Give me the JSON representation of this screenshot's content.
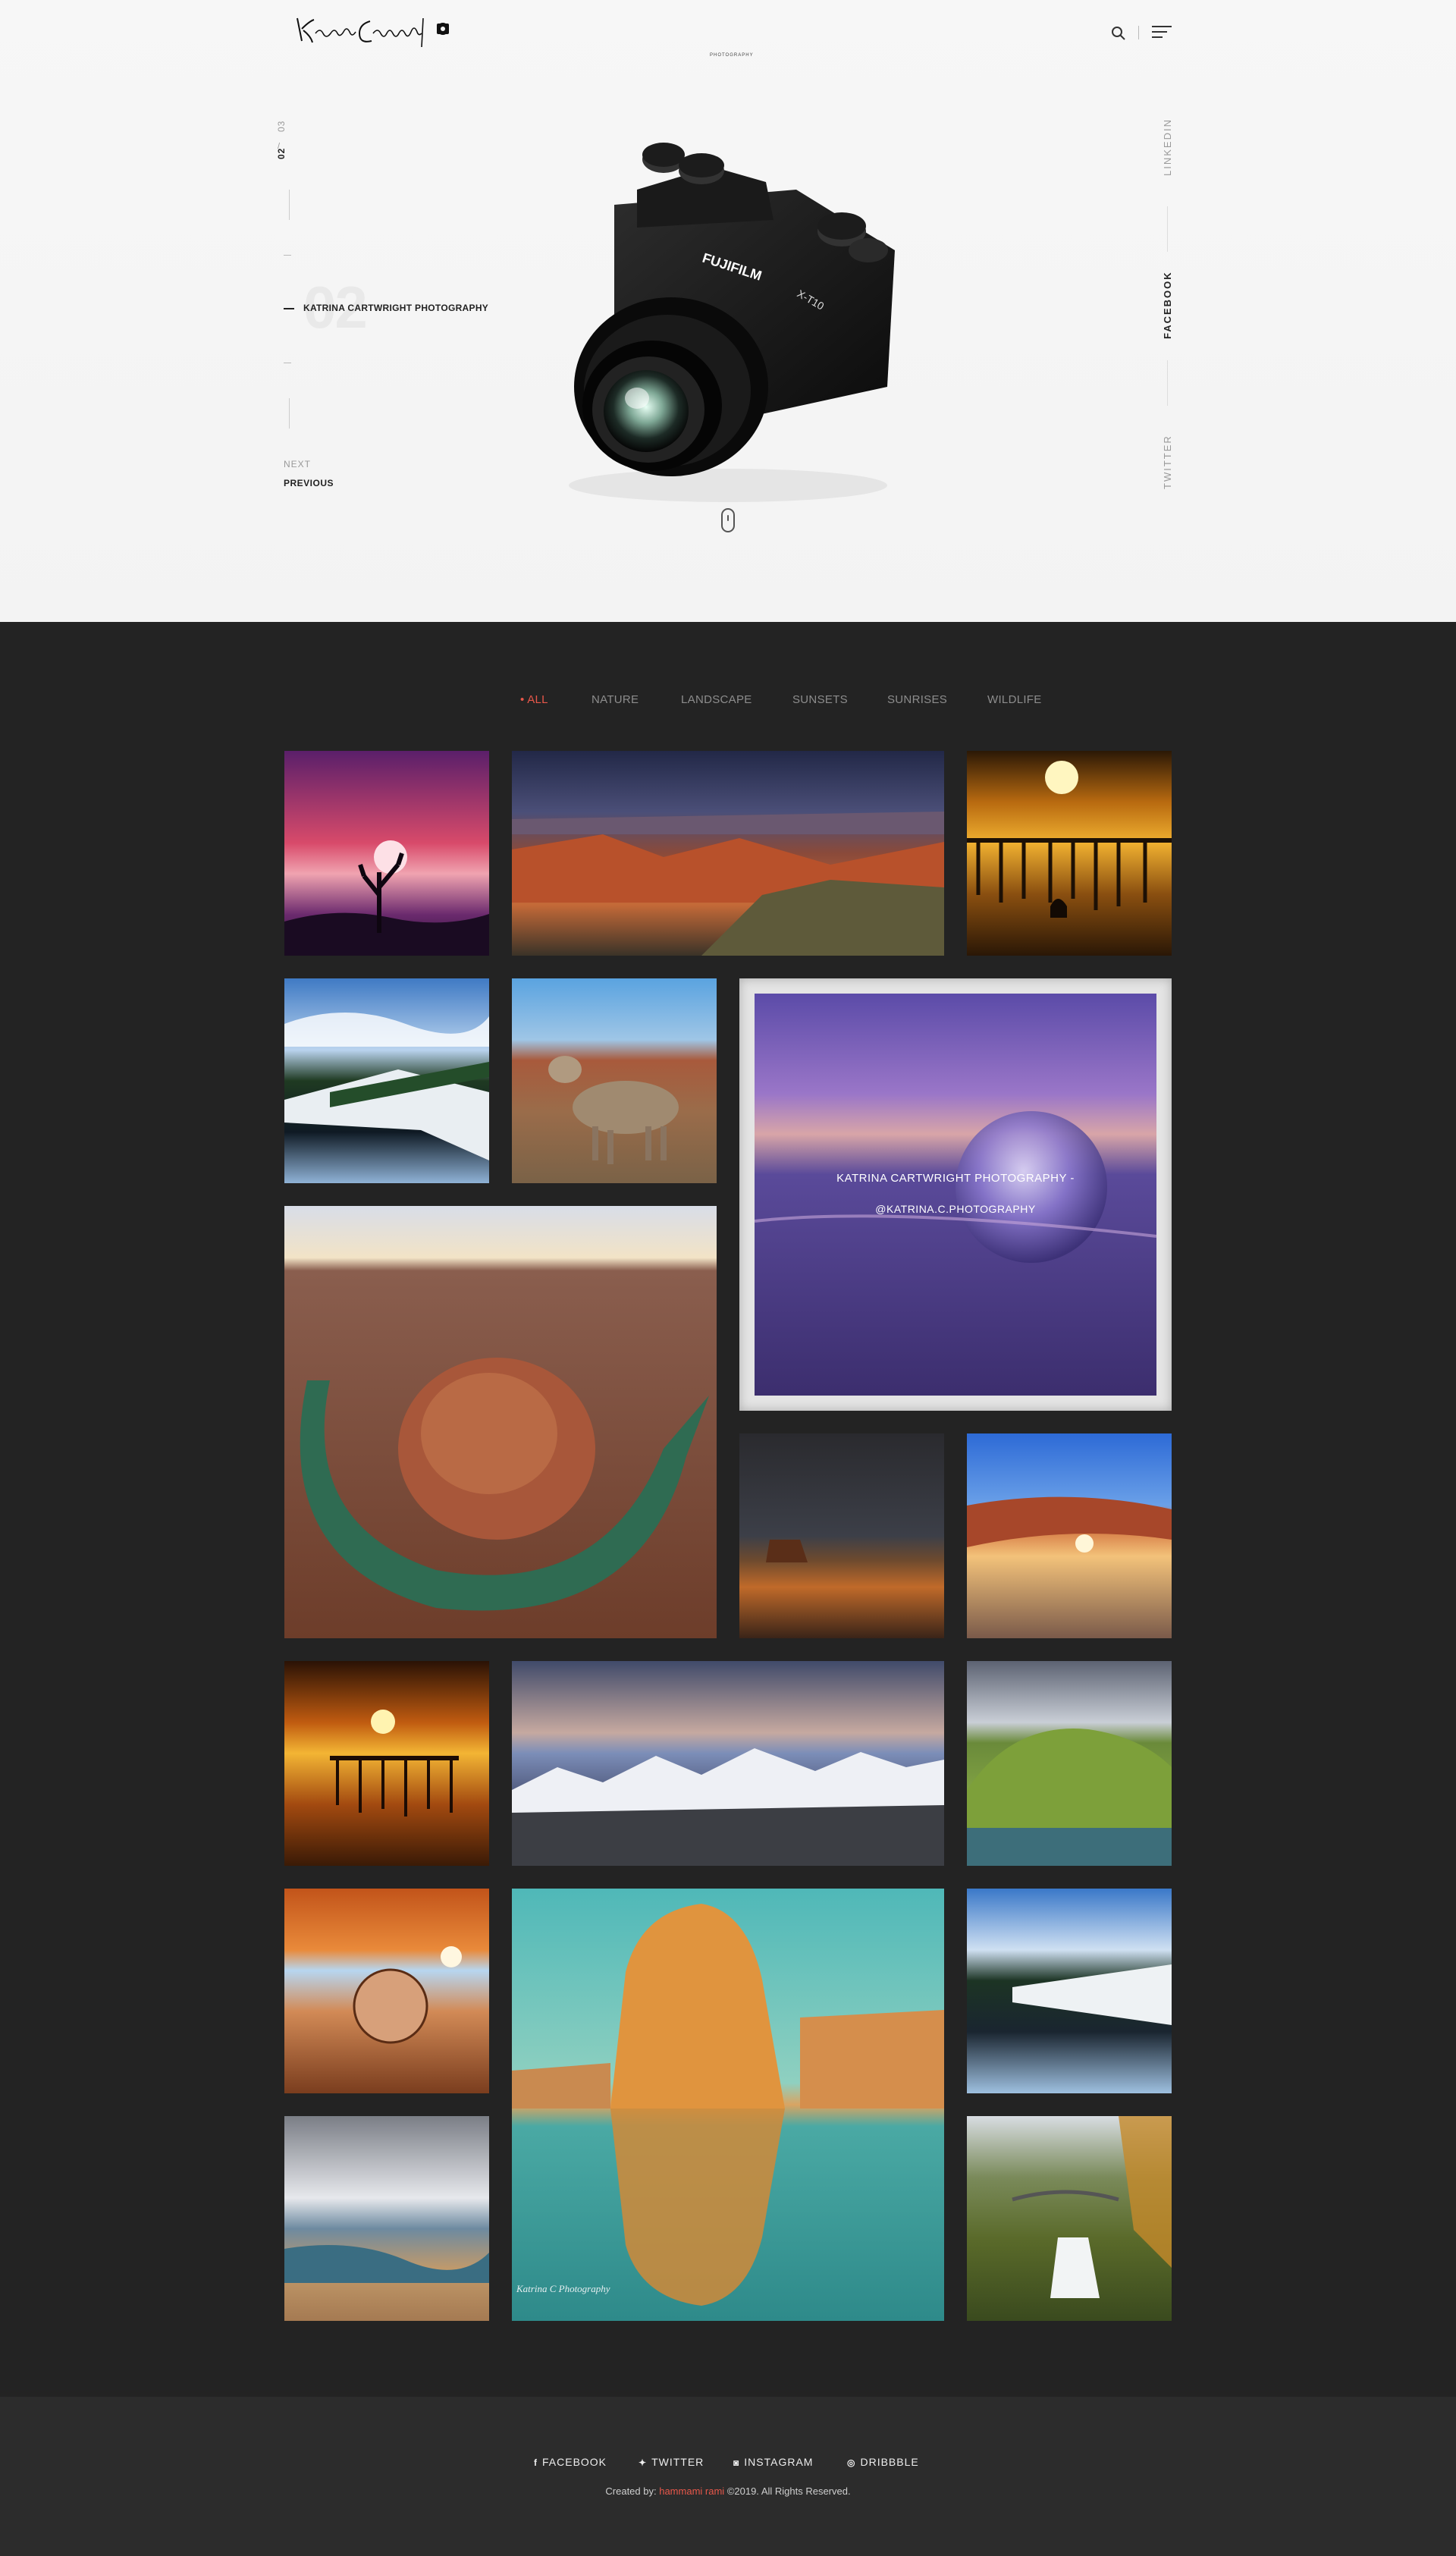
{
  "header": {
    "logo_text": "Katrina Cartwright",
    "logo_sub": "PHOTOGRAPHY"
  },
  "hero": {
    "slide_current": "02",
    "slide_total": "03",
    "slide_separator": "/",
    "big_number": "02",
    "slide_title": "KATRINA CARTWRIGHT PHOTOGRAPHY",
    "next_label": "NEXT",
    "previous_label": "PREVIOUS",
    "social": [
      "LINKEDIN",
      "FACEBOOK",
      "TWITTER"
    ],
    "social_active": "FACEBOOK",
    "camera_brand": "FUJIFILM",
    "camera_model": "X-T10"
  },
  "filters": {
    "items": [
      "ALL",
      "NATURE",
      "LANDSCAPE",
      "SUNSETS",
      "SUNRISES",
      "WILDLIFE"
    ],
    "active": "ALL",
    "active_prefix": "•"
  },
  "feature": {
    "title": "KATRINA CARTWRIGHT PHOTOGRAPHY -",
    "handle": "@KATRINA.C.PHOTOGRAPHY"
  },
  "gallery": {
    "watermark": "Katrina C Photography"
  },
  "footer": {
    "social": [
      {
        "icon": "facebook-icon",
        "glyph": "f",
        "label": "FACEBOOK"
      },
      {
        "icon": "twitter-icon",
        "glyph": "✦",
        "label": "TWITTER"
      },
      {
        "icon": "instagram-icon",
        "glyph": "◙",
        "label": "INSTAGRAM"
      },
      {
        "icon": "dribbble-icon",
        "glyph": "◎",
        "label": "DRIBBBLE"
      }
    ],
    "credits_prefix": "Created by:",
    "credits_author": "hammami rami",
    "credits_suffix": "©2019. All Rights Reserved."
  },
  "colors": {
    "accent": "#e8574a",
    "dark_bg": "#232323",
    "footer_bg": "#2c2c2c",
    "hero_bg": "#f5f5f5"
  }
}
